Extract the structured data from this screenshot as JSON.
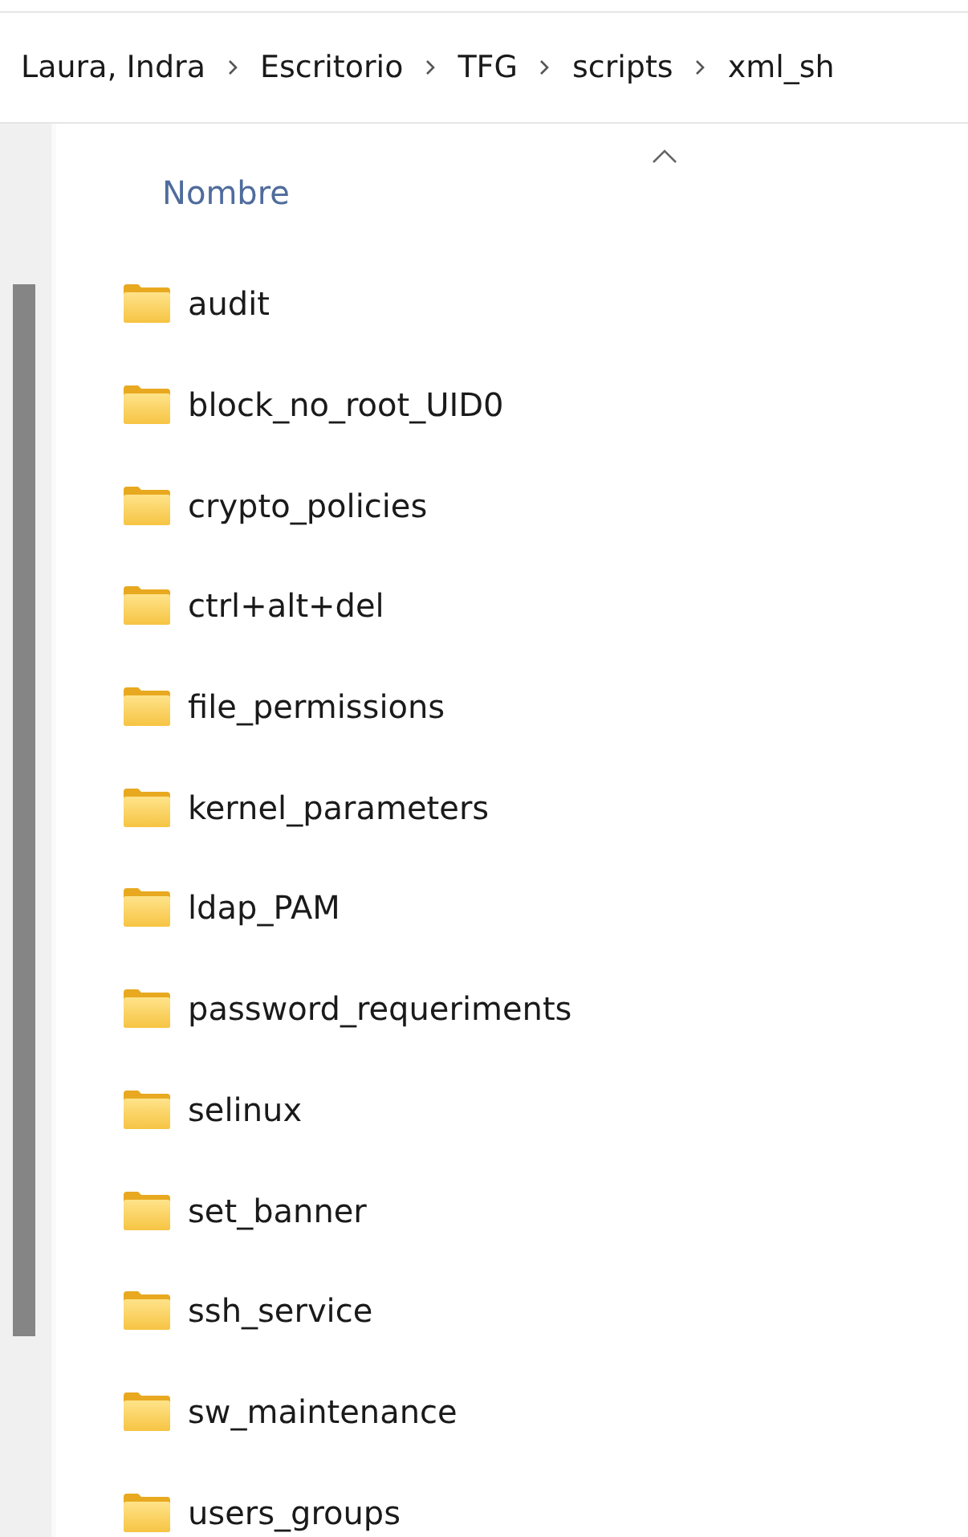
{
  "breadcrumb": [
    "Laura, Indra",
    "Escritorio",
    "TFG",
    "scripts",
    "xml_sh"
  ],
  "column_header": "Nombre",
  "folders": [
    "audit",
    "block_no_root_UID0",
    "crypto_policies",
    "ctrl+alt+del",
    "file_permissions",
    "kernel_parameters",
    "ldap_PAM",
    "password_requeriments",
    "selinux",
    "set_banner",
    "ssh_service",
    "sw_maintenance",
    "users_groups"
  ]
}
